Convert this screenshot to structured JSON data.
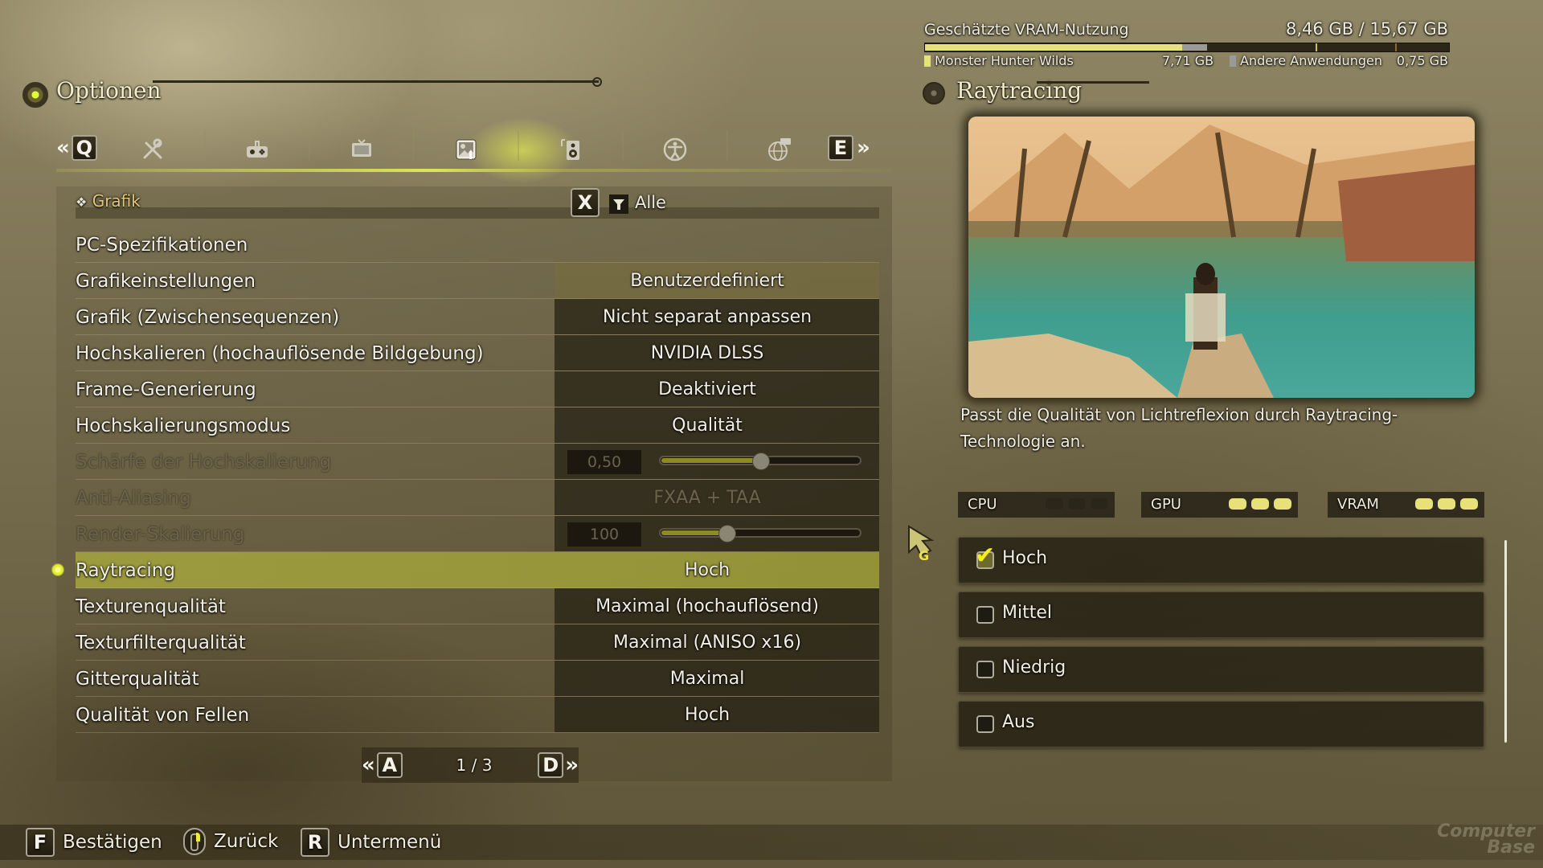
{
  "vram": {
    "title": "Geschätzte VRAM-Nutzung",
    "total": "8,46 GB / 15,67 GB",
    "used_gb": 8.46,
    "capacity_gb": 15.67,
    "game_gb": 7.71,
    "other_gb": 0.75,
    "game_label": "Monster Hunter Wilds",
    "game_value": "7,71 GB",
    "other_label": "Andere Anwendungen",
    "other_value": "0,75 GB",
    "colors": {
      "game": "#e6e27a",
      "other": "#9a9a98"
    }
  },
  "header": {
    "title": "Optionen"
  },
  "tabs": {
    "prev_key": "Q",
    "next_key": "E",
    "prev_chevron": "«",
    "next_chevron": "»",
    "items": [
      {
        "name": "tools-icon"
      },
      {
        "name": "controller-icon"
      },
      {
        "name": "display-icon"
      },
      {
        "name": "graphics-icon",
        "active": true
      },
      {
        "name": "audio-icon"
      },
      {
        "name": "accessibility-icon"
      },
      {
        "name": "language-icon"
      }
    ]
  },
  "filter": {
    "category": "Grafik",
    "key": "X",
    "label": "Alle"
  },
  "settings": [
    {
      "label": "PC-Spezifikationen",
      "value": ""
    },
    {
      "label": "Grafikeinstellungen",
      "value": "Benutzerdefiniert"
    },
    {
      "label": "Grafik (Zwischensequenzen)",
      "value": "Nicht separat anpassen"
    },
    {
      "label": "Hochskalieren (hochauflösende Bildgebung)",
      "value": "NVIDIA DLSS"
    },
    {
      "label": "Frame-Generierung",
      "value": "Deaktiviert"
    },
    {
      "label": "Hochskalierungsmodus",
      "value": "Qualität"
    },
    {
      "label": "Schärfe der Hochskalierung",
      "value": "0,50",
      "slider": 0.5,
      "disabled": true
    },
    {
      "label": "Anti-Aliasing",
      "value": "FXAA + TAA",
      "disabled": true
    },
    {
      "label": "Render-Skalierung",
      "value": "100",
      "slider": 0.33,
      "disabled": true
    },
    {
      "label": "Raytracing",
      "value": "Hoch",
      "selected": true
    },
    {
      "label": "Texturenqualität",
      "value": "Maximal (hochauflösend)"
    },
    {
      "label": "Texturfilterqualität",
      "value": "Maximal (ANISO x16)"
    },
    {
      "label": "Gitterqualität",
      "value": "Maximal"
    },
    {
      "label": "Qualität von Fellen",
      "value": "Hoch"
    }
  ],
  "pager": {
    "prev_key": "A",
    "next_key": "D",
    "prev_chevron": "«",
    "next_chevron": "»",
    "page": "1 / 3"
  },
  "detail": {
    "title": "Raytracing",
    "description": "Passt die Qualität von Lichtreflexion durch Raytracing-Technologie an.",
    "load": [
      {
        "label": "CPU",
        "level": 0,
        "max": 3
      },
      {
        "label": "GPU",
        "level": 3,
        "max": 3
      },
      {
        "label": "VRAM",
        "level": 3,
        "max": 3
      }
    ],
    "options": [
      {
        "label": "Hoch",
        "checked": true
      },
      {
        "label": "Mittel",
        "checked": false
      },
      {
        "label": "Niedrig",
        "checked": false
      },
      {
        "label": "Aus",
        "checked": false
      }
    ],
    "check_glyph": "✔"
  },
  "footer": {
    "confirm_key": "F",
    "confirm_label": "Bestätigen",
    "back_label": "Zurück",
    "submenu_key": "R",
    "submenu_label": "Untermenü"
  },
  "watermark": {
    "line1": "Computer",
    "line2": "Base"
  }
}
